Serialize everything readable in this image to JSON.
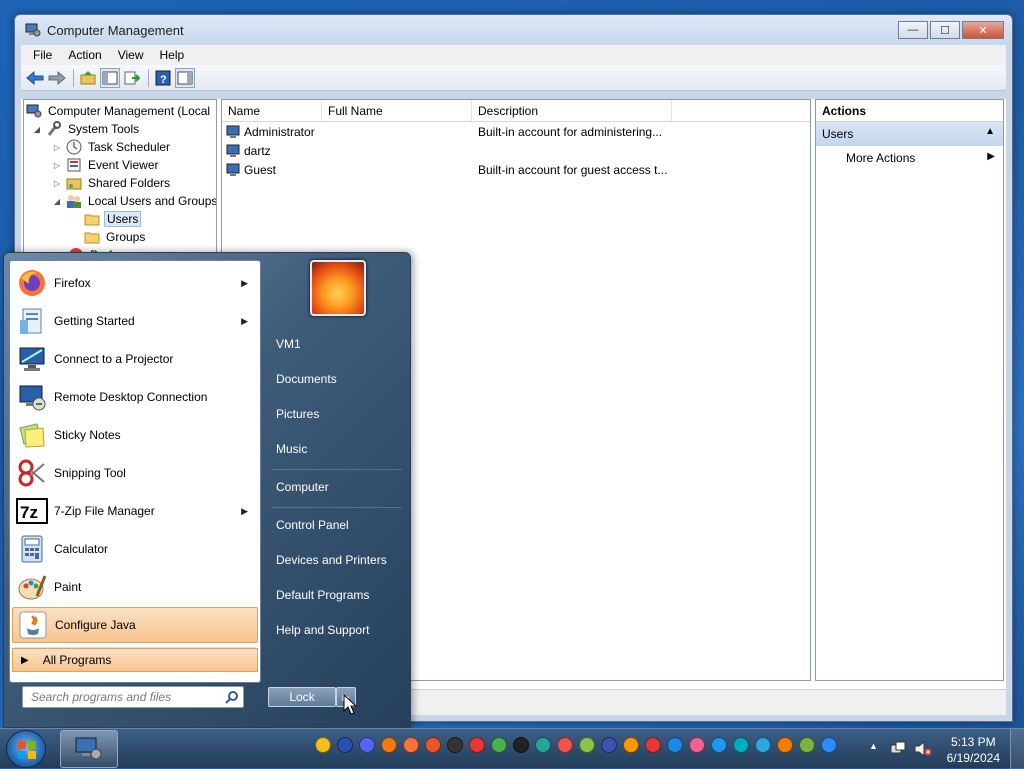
{
  "window": {
    "title": "Computer Management",
    "controls": {
      "minimize": "—",
      "maximize": "☐",
      "close": "✕"
    }
  },
  "menu": [
    "File",
    "Action",
    "View",
    "Help"
  ],
  "tree": {
    "items": [
      {
        "label": "Computer Management (Local",
        "level": 0,
        "expander": ""
      },
      {
        "label": "System Tools",
        "level": 1,
        "expander": "◢"
      },
      {
        "label": "Task Scheduler",
        "level": 2,
        "expander": "▷"
      },
      {
        "label": "Event Viewer",
        "level": 2,
        "expander": "▷"
      },
      {
        "label": "Shared Folders",
        "level": 2,
        "expander": "▷"
      },
      {
        "label": "Local Users and Groups",
        "level": 2,
        "expander": "◢"
      },
      {
        "label": "Users",
        "level": 3,
        "expander": "",
        "selected": true
      },
      {
        "label": "Groups",
        "level": 3,
        "expander": ""
      },
      {
        "label": "Perf",
        "level": 2,
        "expander": ""
      }
    ]
  },
  "list": {
    "columns": [
      "Name",
      "Full Name",
      "Description"
    ],
    "rows": [
      {
        "name": "Administrator",
        "full_name": "",
        "description": "Built-in account for administering..."
      },
      {
        "name": "dartz",
        "full_name": "",
        "description": ""
      },
      {
        "name": "Guest",
        "full_name": "",
        "description": "Built-in account for guest access t..."
      }
    ]
  },
  "actions": {
    "header": "Actions",
    "section": "Users",
    "items": [
      "More Actions"
    ]
  },
  "start_menu": {
    "programs": [
      {
        "label": "Firefox",
        "icon": "firefox-icon",
        "arrow": true
      },
      {
        "label": "Getting Started",
        "icon": "getting-started-icon",
        "arrow": true
      },
      {
        "label": "Connect to a Projector",
        "icon": "projector-icon",
        "arrow": false
      },
      {
        "label": "Remote Desktop Connection",
        "icon": "remote-desktop-icon",
        "arrow": false
      },
      {
        "label": "Sticky Notes",
        "icon": "sticky-notes-icon",
        "arrow": false
      },
      {
        "label": "Snipping Tool",
        "icon": "snipping-tool-icon",
        "arrow": false
      },
      {
        "label": "7-Zip File Manager",
        "icon": "7zip-icon",
        "arrow": true
      },
      {
        "label": "Calculator",
        "icon": "calculator-icon",
        "arrow": false
      },
      {
        "label": "Paint",
        "icon": "paint-icon",
        "arrow": false
      },
      {
        "label": "Configure Java",
        "icon": "java-icon",
        "arrow": false,
        "highlighted": true
      }
    ],
    "all_programs": "All Programs",
    "search_placeholder": "Search programs and files",
    "right_items": [
      "VM1",
      "Documents",
      "Pictures",
      "Music",
      "Computer",
      "Control Panel",
      "Devices and Printers",
      "Default Programs",
      "Help and Support"
    ],
    "lock_label": "Lock",
    "seven_zip_glyph": "7z"
  },
  "taskbar": {
    "clock_time": "5:13 PM",
    "clock_date": "6/19/2024",
    "tray_apps": [
      "#f4c020",
      "#2a4fb0",
      "#5865f2",
      "#f07a12",
      "#ff7139",
      "#e8572c",
      "#333333",
      "#e53935",
      "#4caf50",
      "#222222",
      "#26a69a",
      "#ef5350",
      "#8bc34a",
      "#3f51b5",
      "#ff9800",
      "#e53935",
      "#1e88e5",
      "#f06292",
      "#2196f3",
      "#00acc1",
      "#2ca5e0",
      "#f57c00",
      "#7cb342",
      "#2d8cff"
    ],
    "colors": {
      "accent": "#2d5c8c"
    }
  }
}
